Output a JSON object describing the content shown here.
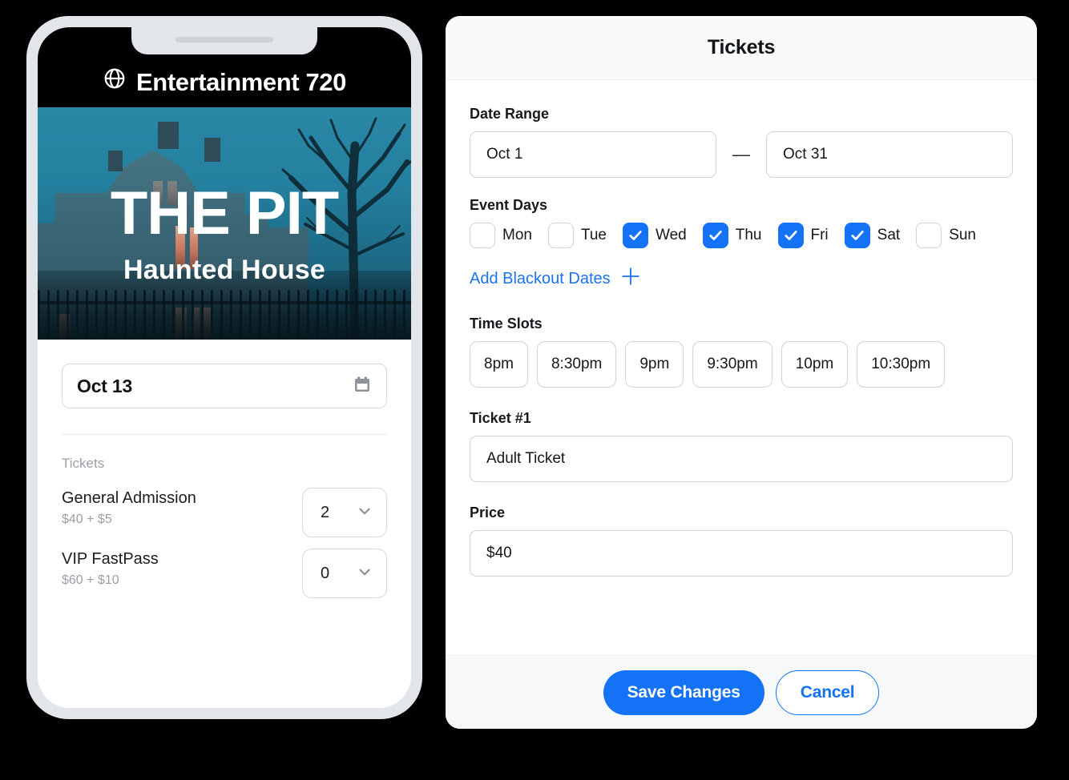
{
  "phone": {
    "app_title": "Entertainment 720",
    "globe_icon": "globe-icon",
    "hero": {
      "title": "THE PIT",
      "subtitle": "Haunted House"
    },
    "date_field": {
      "value": "Oct 13",
      "icon": "calendar-icon"
    },
    "tickets_section_label": "Tickets",
    "ticket_rows": [
      {
        "name": "General Admission",
        "price": "$40 + $5",
        "quantity": "2"
      },
      {
        "name": "VIP FastPass",
        "price": "$60 + $10",
        "quantity": "0"
      }
    ]
  },
  "modal": {
    "title": "Tickets",
    "date_range": {
      "label": "Date Range",
      "start": "Oct 1",
      "separator": "—",
      "end": "Oct 31"
    },
    "event_days": {
      "label": "Event Days",
      "days": [
        {
          "label": "Mon",
          "checked": false
        },
        {
          "label": "Tue",
          "checked": false
        },
        {
          "label": "Wed",
          "checked": true
        },
        {
          "label": "Thu",
          "checked": true
        },
        {
          "label": "Fri",
          "checked": true
        },
        {
          "label": "Sat",
          "checked": true
        },
        {
          "label": "Sun",
          "checked": false
        }
      ],
      "blackout_link": "Add Blackout Dates",
      "blackout_icon": "plus-icon"
    },
    "time_slots": {
      "label": "Time Slots",
      "slots": [
        "8pm",
        "8:30pm",
        "9pm",
        "9:30pm",
        "10pm",
        "10:30pm"
      ]
    },
    "ticket_name_field": {
      "label": "Ticket #1",
      "value": "Adult Ticket"
    },
    "price_field": {
      "label": "Price",
      "value": "$40"
    },
    "footer": {
      "save_label": "Save Changes",
      "cancel_label": "Cancel"
    }
  },
  "colors": {
    "accent_blue": "#1372f5",
    "link_blue": "#1a73f0",
    "hero_teal": "#24809f",
    "page_background": "#000000",
    "phone_bezel": "#e2e6ea"
  }
}
